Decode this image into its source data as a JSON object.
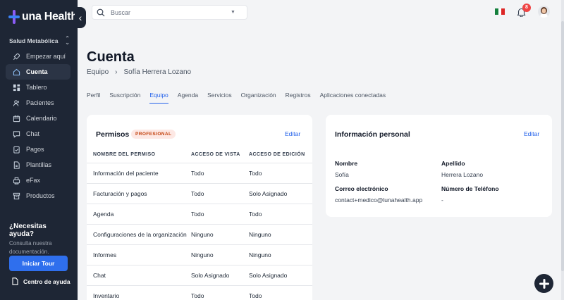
{
  "app": {
    "name": "una Health",
    "brand_color": "#2f6fed",
    "sidebar_color": "#1e2635"
  },
  "sidebar": {
    "org_label": "Salud Metabólica",
    "items": [
      {
        "label": "Empezar aquí",
        "icon": "rocket-icon"
      },
      {
        "label": "Cuenta",
        "icon": "home-icon",
        "active": true
      },
      {
        "label": "Tablero",
        "icon": "grid-icon"
      },
      {
        "label": "Pacientes",
        "icon": "users-icon"
      },
      {
        "label": "Calendario",
        "icon": "calendar-icon"
      },
      {
        "label": "Chat",
        "icon": "chat-icon"
      },
      {
        "label": "Pagos",
        "icon": "clipboard-check-icon"
      },
      {
        "label": "Plantillas",
        "icon": "file-icon"
      },
      {
        "label": "eFax",
        "icon": "fax-icon"
      },
      {
        "label": "Productos",
        "icon": "package-icon"
      }
    ],
    "help": {
      "title": "¿Necesitas ayuda?",
      "subtitle": "Consulta nuestra documentación.",
      "tour_button": "Iniciar Tour",
      "help_center": "Centro de ayuda"
    }
  },
  "topbar": {
    "search_placeholder": "Buscar",
    "notifications_count": "8"
  },
  "page": {
    "title": "Cuenta",
    "breadcrumb": [
      "Equipo",
      "Sofía Herrera Lozano"
    ],
    "tabs": [
      {
        "label": "Perfil"
      },
      {
        "label": "Suscripción"
      },
      {
        "label": "Equipo",
        "active": true
      },
      {
        "label": "Agenda"
      },
      {
        "label": "Servicios"
      },
      {
        "label": "Organización"
      },
      {
        "label": "Registros"
      },
      {
        "label": "Aplicaciones conectadas"
      }
    ]
  },
  "permissions": {
    "title": "Permisos",
    "badge": "PROFESIONAL",
    "edit_label": "Editar",
    "columns": [
      "NOMBRE DEL PERMISO",
      "ACCESO DE VISTA",
      "ACCESO DE EDICIÓN"
    ],
    "rows": [
      [
        "Información del paciente",
        "Todo",
        "Todo"
      ],
      [
        "Facturación y pagos",
        "Todo",
        "Solo Asignado"
      ],
      [
        "Agenda",
        "Todo",
        "Todo"
      ],
      [
        "Configuraciones de la organización",
        "Ninguno",
        "Ninguno"
      ],
      [
        "Informes",
        "Ninguno",
        "Ninguno"
      ],
      [
        "Chat",
        "Solo Asignado",
        "Solo Asignado"
      ],
      [
        "Inventario",
        "Todo",
        "Todo"
      ]
    ]
  },
  "personal_info": {
    "title": "Información personal",
    "edit_label": "Editar",
    "first_name_label": "Nombre",
    "first_name": "Sofía",
    "last_name_label": "Apellido",
    "last_name": "Herrera Lozano",
    "email_label": "Correo electrónico",
    "email": "contact+medico@lunahealth.app",
    "phone_label": "Número de Teléfono",
    "phone": "-"
  }
}
